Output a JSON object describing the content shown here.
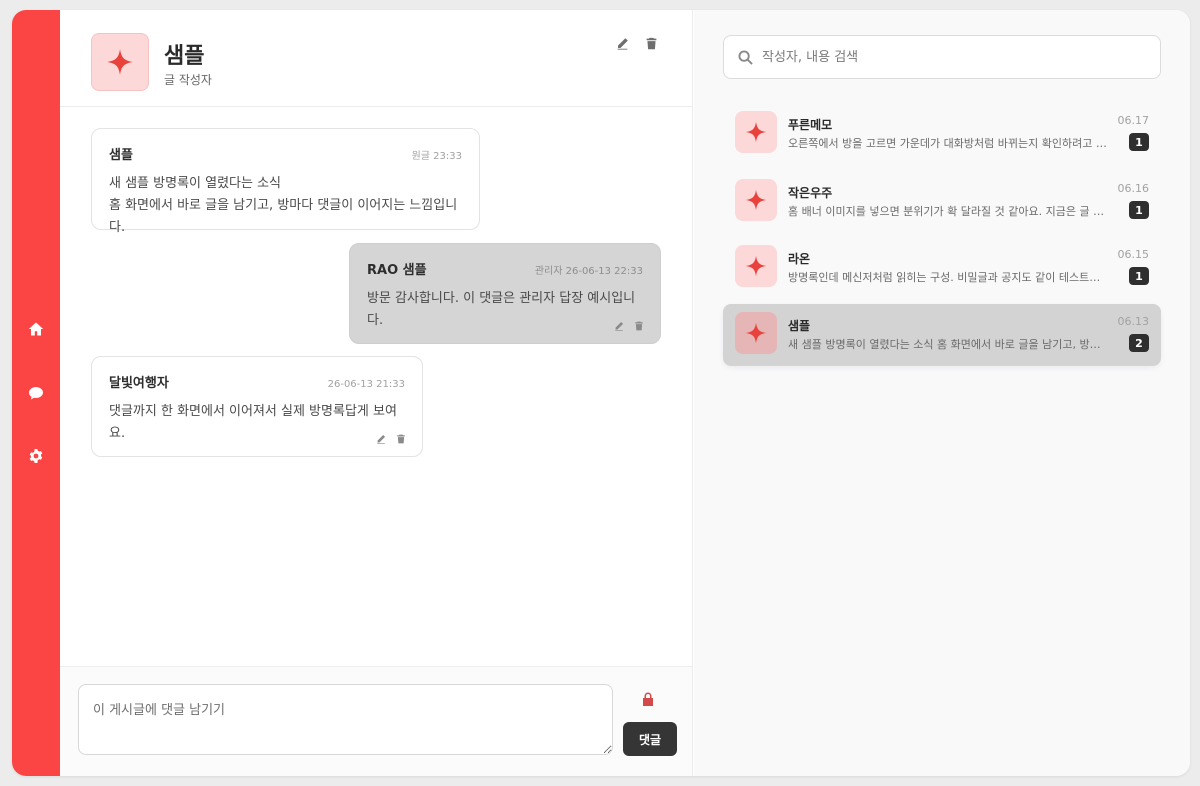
{
  "sidebar": {
    "items": [
      {
        "icon": "home-icon"
      },
      {
        "icon": "chat-icon"
      },
      {
        "icon": "gear-icon"
      }
    ]
  },
  "thread": {
    "title": "샘플",
    "subtitle": "글 작성자",
    "avatar_icon": "sparkle-icon"
  },
  "messages": [
    {
      "author": "샘플",
      "time": "원글 23:33",
      "body_line1": "새 샘플 방명록이 열렸다는 소식",
      "body_line2": "홈 화면에서 바로 글을 남기고, 방마다 댓글이 이어지는 느낌입니다."
    },
    {
      "author": "RAO 샘플",
      "time": "관리자 26-06-13 22:33",
      "body_line1": "방문 감사합니다. 이 댓글은 관리자 답장 예시입니다."
    },
    {
      "author": "달빛여행자",
      "time": "26-06-13 21:33",
      "body_line1": "댓글까지 한 화면에서 이어져서 실제 방명록답게 보여요."
    }
  ],
  "composer": {
    "placeholder": "이 게시글에 댓글 남기기",
    "submit_label": "댓글"
  },
  "search": {
    "placeholder": "작성자, 내용 검색"
  },
  "list": [
    {
      "name": "푸른메모",
      "preview": "오른쪽에서 방을 고르면 가운데가 대화방처럼 바뀌는지 확인하려고 남겨요.",
      "date": "06.17",
      "count": "1"
    },
    {
      "name": "작은우주",
      "preview": "홈 배너 이미지를 넣으면 분위기가 확 달라질 것 같아요. 지금은 글 흐름이 좋네요.",
      "date": "06.16",
      "count": "1"
    },
    {
      "name": "라온",
      "preview": "방명록인데 메신저처럼 읽히는 구성. 비밀글과 공지도 같이 테스트해볼게요.",
      "date": "06.15",
      "count": "1"
    },
    {
      "name": "샘플",
      "preview": "새 샘플 방명록이 열렸다는 소식 홈 화면에서 바로 글을 남기고, 방마다 댓글이 이어지는 느낌입니다.",
      "date": "06.13",
      "count": "2"
    }
  ],
  "colors": {
    "accent": "#fb4444",
    "avatar_bg": "#fcd8d8",
    "active_row": "#d3d3d3",
    "button_dark": "#353535"
  }
}
